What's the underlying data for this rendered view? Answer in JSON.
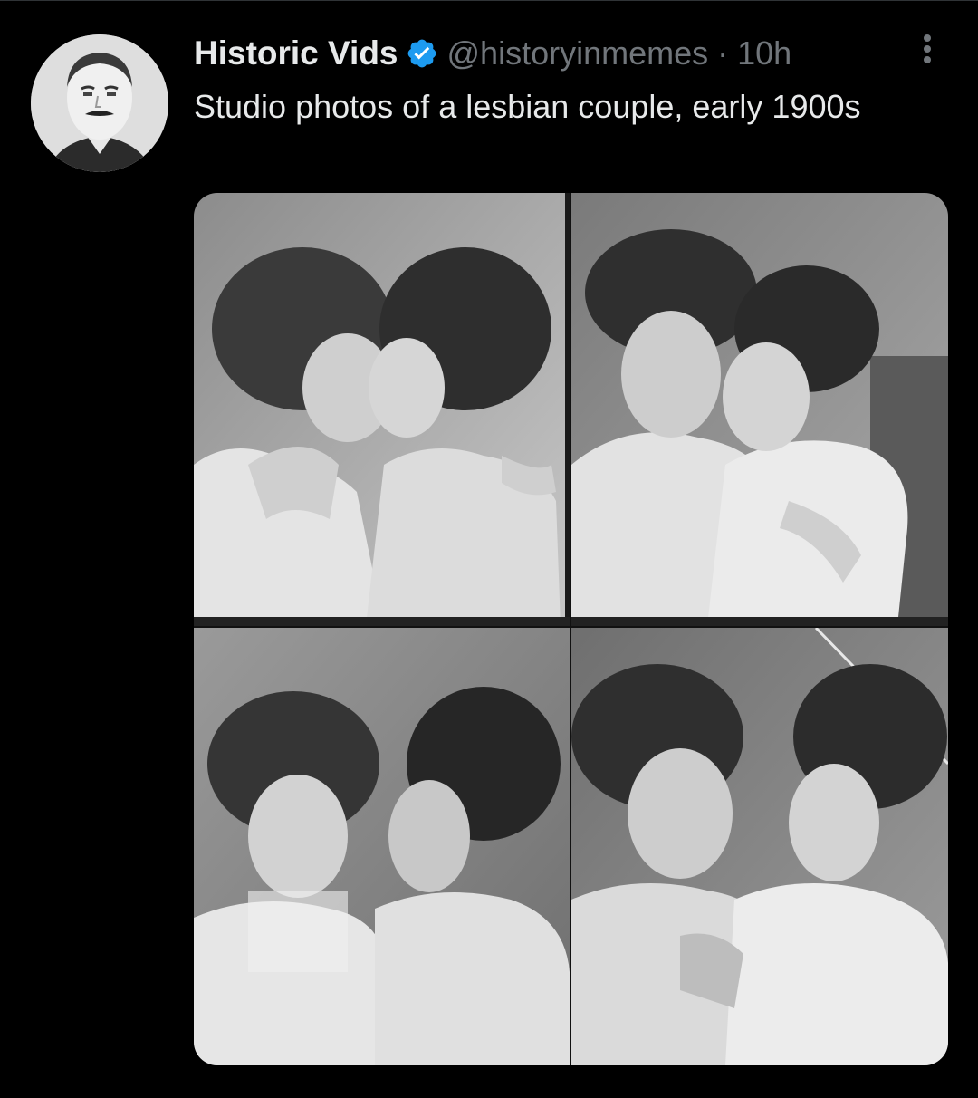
{
  "tweet": {
    "display_name": "Historic Vids",
    "handle": "@historyinmemes",
    "separator": "·",
    "timestamp": "10h",
    "text": "Studio photos of a lesbian couple, early 1900s",
    "verified": true,
    "avatar_icon": "portrait-avatar-icon",
    "more_icon": "more-options-icon"
  },
  "media": {
    "photo_count": 4,
    "style": "black-and-white vintage studio photographs",
    "colors": {
      "photo_light": "#d9d9d9",
      "photo_mid": "#8a8a8a",
      "photo_dark": "#2a2a2a"
    }
  },
  "theme": {
    "background": "#000000",
    "primary_text": "#e7e9ea",
    "secondary_text": "#71767b",
    "verified_blue": "#1d9bf0"
  }
}
